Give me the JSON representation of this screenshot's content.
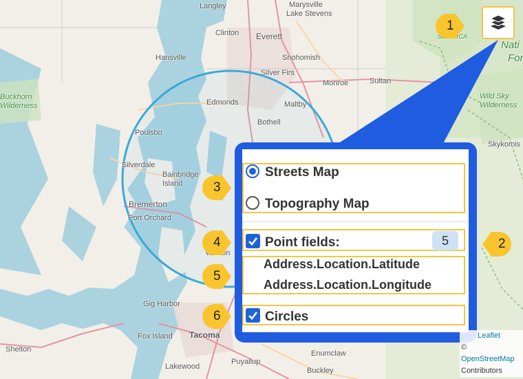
{
  "map": {
    "places": [
      {
        "id": "langley",
        "name": "Langley"
      },
      {
        "id": "marysville",
        "name": "Marysville"
      },
      {
        "id": "lake-stevens",
        "name": "Lake Stevens"
      },
      {
        "id": "clinton",
        "name": "Clinton"
      },
      {
        "id": "everett",
        "name": "Everett"
      },
      {
        "id": "hansville",
        "name": "Hansville"
      },
      {
        "id": "snohomish",
        "name": "Snohomish"
      },
      {
        "id": "silver-firs",
        "name": "Silver Firs"
      },
      {
        "id": "monroe",
        "name": "Monroe"
      },
      {
        "id": "sultan",
        "name": "Sultan"
      },
      {
        "id": "buckhorn",
        "name": "Buckhorn\nWilderness"
      },
      {
        "id": "edmonds",
        "name": "Edmonds"
      },
      {
        "id": "maltby",
        "name": "Maltby"
      },
      {
        "id": "bothell",
        "name": "Bothell"
      },
      {
        "id": "wild-sky",
        "name": "Wild Sky\nWilderness"
      },
      {
        "id": "poulsbo",
        "name": "Poulsbo"
      },
      {
        "id": "skykomish",
        "name": "Skykomis"
      },
      {
        "id": "silverdale",
        "name": "Silverdale"
      },
      {
        "id": "bainbridge",
        "name": "Bainbridge\nIsland"
      },
      {
        "id": "bremerton",
        "name": "Bremerton"
      },
      {
        "id": "port-orchard",
        "name": "Port Orchard"
      },
      {
        "id": "vashon",
        "name": "Vashon"
      },
      {
        "id": "gig-harbor",
        "name": "Gig Harbor"
      },
      {
        "id": "fox-island",
        "name": "Fox Island"
      },
      {
        "id": "tacoma",
        "name": "Tacoma"
      },
      {
        "id": "shelton",
        "name": "Shelton"
      },
      {
        "id": "lakewood",
        "name": "Lakewood"
      },
      {
        "id": "puyallup",
        "name": "Puyallup"
      },
      {
        "id": "enumclaw",
        "name": "Enumclaw"
      },
      {
        "id": "buckley",
        "name": "Buckley"
      },
      {
        "id": "nrca",
        "name": "Stat NRCA"
      },
      {
        "id": "natl",
        "name": "Nati"
      },
      {
        "id": "for",
        "name": "For"
      }
    ]
  },
  "layers_control": {
    "icon": "layers-icon",
    "base_layers": [
      "Streets Map",
      "Topography Map"
    ],
    "selected_base_layer": "Streets Map",
    "point_fields_label": "Point fields:",
    "point_fields_checked": true,
    "point_fields_count": "5",
    "fields": [
      "Address.Location.Latitude",
      "Address.Location.Longitude"
    ],
    "circles_label": "Circles",
    "circles_checked": true
  },
  "callouts": [
    "1",
    "2",
    "3",
    "4",
    "5",
    "6"
  ],
  "attribution": {
    "leaflet": "Leaflet",
    "copyright": "©",
    "osm": "OpenStreetMap",
    "contributors": "Contributors"
  },
  "colors": {
    "panel_bg": "#1f5ce0",
    "highlight": "#f4c542",
    "callout": "#f9c52e",
    "water": "#aad3df",
    "accent": "#1f62d8"
  }
}
